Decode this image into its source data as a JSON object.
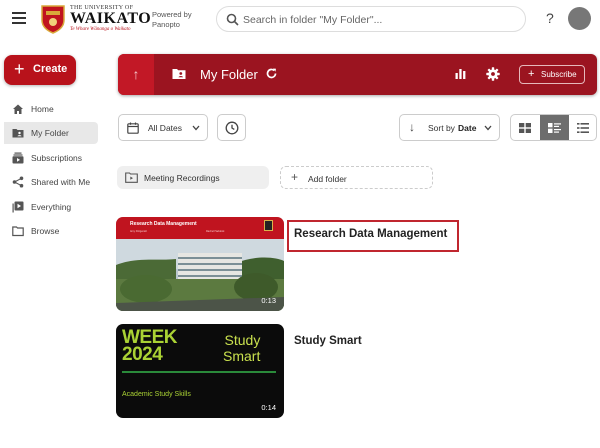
{
  "header": {
    "logo": {
      "line1": "THE UNIVERSITY OF",
      "line2": "WAIKATO",
      "tagline": "Te Whare Wānanga o Waikato"
    },
    "powered_by": "Powered by",
    "powered_name": "Panopto",
    "search_placeholder": "Search in folder \"My Folder\"...",
    "help_label": "?"
  },
  "sidebar": {
    "create_label": "Create",
    "items": [
      {
        "label": "Home",
        "icon": "home-icon"
      },
      {
        "label": "My Folder",
        "icon": "folder-user-icon",
        "active": true
      },
      {
        "label": "Subscriptions",
        "icon": "subscriptions-icon"
      },
      {
        "label": "Shared with Me",
        "icon": "share-icon"
      },
      {
        "label": "Everything",
        "icon": "video-library-icon"
      },
      {
        "label": "Browse",
        "icon": "folder-icon"
      }
    ]
  },
  "folder": {
    "title": "My Folder",
    "subscribe_label": "Subscribe",
    "up_arrow": "↑"
  },
  "filters": {
    "dates_label": "All Dates",
    "sort_prefix": "Sort by",
    "sort_value": "Date",
    "view_active": "detail"
  },
  "folders_row": {
    "subfolder": "Meeting Recordings",
    "add_folder": "Add folder"
  },
  "sessions": [
    {
      "title": "Research Data Management",
      "duration": "0:13",
      "thumb_title": "Research Data Management",
      "thumb_sub_left": "Amy Fitzgerald",
      "thumb_sub_right": "Rachel Haddock"
    },
    {
      "title": "Study Smart",
      "duration": "0:14",
      "thumb_week": "WEEK",
      "thumb_year": "2024",
      "thumb_study": "Study",
      "thumb_smart": "Smart",
      "thumb_skill": "Academic Study Skills"
    }
  ],
  "colors": {
    "brand_red": "#b8121b",
    "banner_red": "#9b1420",
    "accent_green": "#aad234"
  }
}
